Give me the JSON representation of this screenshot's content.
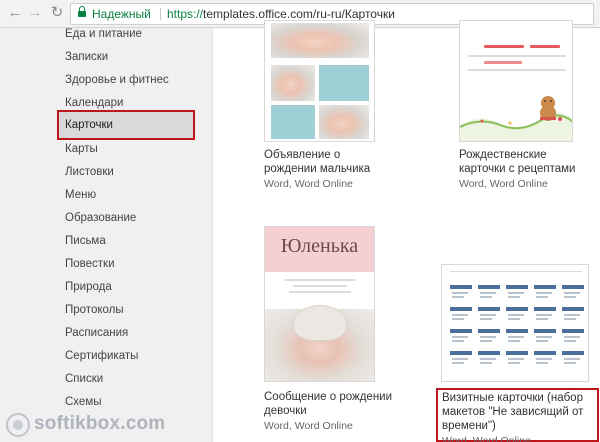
{
  "browser": {
    "back_icon": "←",
    "forward_icon": "→",
    "reload_icon": "↻",
    "security_label": "Надежный",
    "url_protocol": "https://",
    "url_rest": "templates.office.com/ru-ru/Карточки"
  },
  "sidebar": {
    "items": [
      {
        "label": "Еда и питание"
      },
      {
        "label": "Записки"
      },
      {
        "label": "Здоровье и фитнес"
      },
      {
        "label": "Календари"
      },
      {
        "label": "Карточки",
        "selected": true
      },
      {
        "label": "Карты"
      },
      {
        "label": "Листовки"
      },
      {
        "label": "Меню"
      },
      {
        "label": "Образование"
      },
      {
        "label": "Письма"
      },
      {
        "label": "Повестки"
      },
      {
        "label": "Природа"
      },
      {
        "label": "Протоколы"
      },
      {
        "label": "Расписания"
      },
      {
        "label": "Сертификаты"
      },
      {
        "label": "Списки"
      },
      {
        "label": "Схемы"
      }
    ]
  },
  "cards": [
    {
      "title_line1": "Объявление о",
      "title_line2": "рождении мальчика",
      "apps": "Word, Word Online"
    },
    {
      "title_line1": "Рождественские",
      "title_line2": "карточки с рецептами",
      "apps": "Word, Word Online"
    },
    {
      "title_line1": "Сообщение о рождении",
      "title_line2": "девочки",
      "apps": "Word, Word Online",
      "thumb_name": "Юленька"
    },
    {
      "title_line1": "Визитные карточки (набор",
      "title_line2": "макетов \"Не зависящий от",
      "title_line3": "времени\")",
      "apps": "Word, Word Online"
    }
  ],
  "watermark": {
    "text": "softikbox.com"
  },
  "colors": {
    "highlight": "#c0141b",
    "secure_green": "#0b8043",
    "sidebar_bg": "#f0f0f0"
  }
}
